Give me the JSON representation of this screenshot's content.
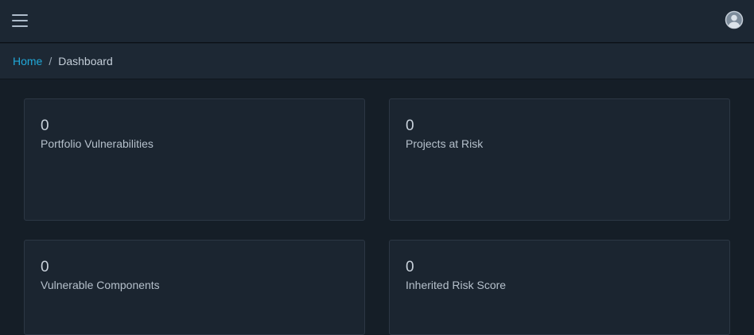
{
  "header": {
    "menu_icon": "hamburger-menu-icon",
    "user_icon": "user-avatar-icon"
  },
  "breadcrumb": {
    "home": "Home",
    "separator": "/",
    "current": "Dashboard"
  },
  "cards": [
    {
      "value": "0",
      "label": "Portfolio Vulnerabilities"
    },
    {
      "value": "0",
      "label": "Projects at Risk"
    },
    {
      "value": "0",
      "label": "Vulnerable Components"
    },
    {
      "value": "0",
      "label": "Inherited Risk Score"
    }
  ],
  "colors": {
    "accent": "#20a8d8",
    "background": "#151e27",
    "header": "#1c2733",
    "card": "#1b2530"
  }
}
